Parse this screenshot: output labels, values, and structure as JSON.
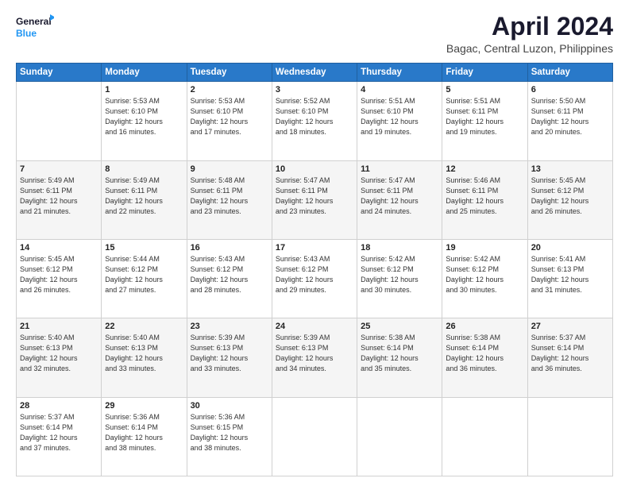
{
  "logo": {
    "line1": "General",
    "line2": "Blue"
  },
  "title": "April 2024",
  "subtitle": "Bagac, Central Luzon, Philippines",
  "days_header": [
    "Sunday",
    "Monday",
    "Tuesday",
    "Wednesday",
    "Thursday",
    "Friday",
    "Saturday"
  ],
  "weeks": [
    [
      {
        "day": "",
        "info": ""
      },
      {
        "day": "1",
        "info": "Sunrise: 5:53 AM\nSunset: 6:10 PM\nDaylight: 12 hours\nand 16 minutes."
      },
      {
        "day": "2",
        "info": "Sunrise: 5:53 AM\nSunset: 6:10 PM\nDaylight: 12 hours\nand 17 minutes."
      },
      {
        "day": "3",
        "info": "Sunrise: 5:52 AM\nSunset: 6:10 PM\nDaylight: 12 hours\nand 18 minutes."
      },
      {
        "day": "4",
        "info": "Sunrise: 5:51 AM\nSunset: 6:10 PM\nDaylight: 12 hours\nand 19 minutes."
      },
      {
        "day": "5",
        "info": "Sunrise: 5:51 AM\nSunset: 6:11 PM\nDaylight: 12 hours\nand 19 minutes."
      },
      {
        "day": "6",
        "info": "Sunrise: 5:50 AM\nSunset: 6:11 PM\nDaylight: 12 hours\nand 20 minutes."
      }
    ],
    [
      {
        "day": "7",
        "info": "Sunrise: 5:49 AM\nSunset: 6:11 PM\nDaylight: 12 hours\nand 21 minutes."
      },
      {
        "day": "8",
        "info": "Sunrise: 5:49 AM\nSunset: 6:11 PM\nDaylight: 12 hours\nand 22 minutes."
      },
      {
        "day": "9",
        "info": "Sunrise: 5:48 AM\nSunset: 6:11 PM\nDaylight: 12 hours\nand 23 minutes."
      },
      {
        "day": "10",
        "info": "Sunrise: 5:47 AM\nSunset: 6:11 PM\nDaylight: 12 hours\nand 23 minutes."
      },
      {
        "day": "11",
        "info": "Sunrise: 5:47 AM\nSunset: 6:11 PM\nDaylight: 12 hours\nand 24 minutes."
      },
      {
        "day": "12",
        "info": "Sunrise: 5:46 AM\nSunset: 6:11 PM\nDaylight: 12 hours\nand 25 minutes."
      },
      {
        "day": "13",
        "info": "Sunrise: 5:45 AM\nSunset: 6:12 PM\nDaylight: 12 hours\nand 26 minutes."
      }
    ],
    [
      {
        "day": "14",
        "info": "Sunrise: 5:45 AM\nSunset: 6:12 PM\nDaylight: 12 hours\nand 26 minutes."
      },
      {
        "day": "15",
        "info": "Sunrise: 5:44 AM\nSunset: 6:12 PM\nDaylight: 12 hours\nand 27 minutes."
      },
      {
        "day": "16",
        "info": "Sunrise: 5:43 AM\nSunset: 6:12 PM\nDaylight: 12 hours\nand 28 minutes."
      },
      {
        "day": "17",
        "info": "Sunrise: 5:43 AM\nSunset: 6:12 PM\nDaylight: 12 hours\nand 29 minutes."
      },
      {
        "day": "18",
        "info": "Sunrise: 5:42 AM\nSunset: 6:12 PM\nDaylight: 12 hours\nand 30 minutes."
      },
      {
        "day": "19",
        "info": "Sunrise: 5:42 AM\nSunset: 6:12 PM\nDaylight: 12 hours\nand 30 minutes."
      },
      {
        "day": "20",
        "info": "Sunrise: 5:41 AM\nSunset: 6:13 PM\nDaylight: 12 hours\nand 31 minutes."
      }
    ],
    [
      {
        "day": "21",
        "info": "Sunrise: 5:40 AM\nSunset: 6:13 PM\nDaylight: 12 hours\nand 32 minutes."
      },
      {
        "day": "22",
        "info": "Sunrise: 5:40 AM\nSunset: 6:13 PM\nDaylight: 12 hours\nand 33 minutes."
      },
      {
        "day": "23",
        "info": "Sunrise: 5:39 AM\nSunset: 6:13 PM\nDaylight: 12 hours\nand 33 minutes."
      },
      {
        "day": "24",
        "info": "Sunrise: 5:39 AM\nSunset: 6:13 PM\nDaylight: 12 hours\nand 34 minutes."
      },
      {
        "day": "25",
        "info": "Sunrise: 5:38 AM\nSunset: 6:14 PM\nDaylight: 12 hours\nand 35 minutes."
      },
      {
        "day": "26",
        "info": "Sunrise: 5:38 AM\nSunset: 6:14 PM\nDaylight: 12 hours\nand 36 minutes."
      },
      {
        "day": "27",
        "info": "Sunrise: 5:37 AM\nSunset: 6:14 PM\nDaylight: 12 hours\nand 36 minutes."
      }
    ],
    [
      {
        "day": "28",
        "info": "Sunrise: 5:37 AM\nSunset: 6:14 PM\nDaylight: 12 hours\nand 37 minutes."
      },
      {
        "day": "29",
        "info": "Sunrise: 5:36 AM\nSunset: 6:14 PM\nDaylight: 12 hours\nand 38 minutes."
      },
      {
        "day": "30",
        "info": "Sunrise: 5:36 AM\nSunset: 6:15 PM\nDaylight: 12 hours\nand 38 minutes."
      },
      {
        "day": "",
        "info": ""
      },
      {
        "day": "",
        "info": ""
      },
      {
        "day": "",
        "info": ""
      },
      {
        "day": "",
        "info": ""
      }
    ]
  ]
}
